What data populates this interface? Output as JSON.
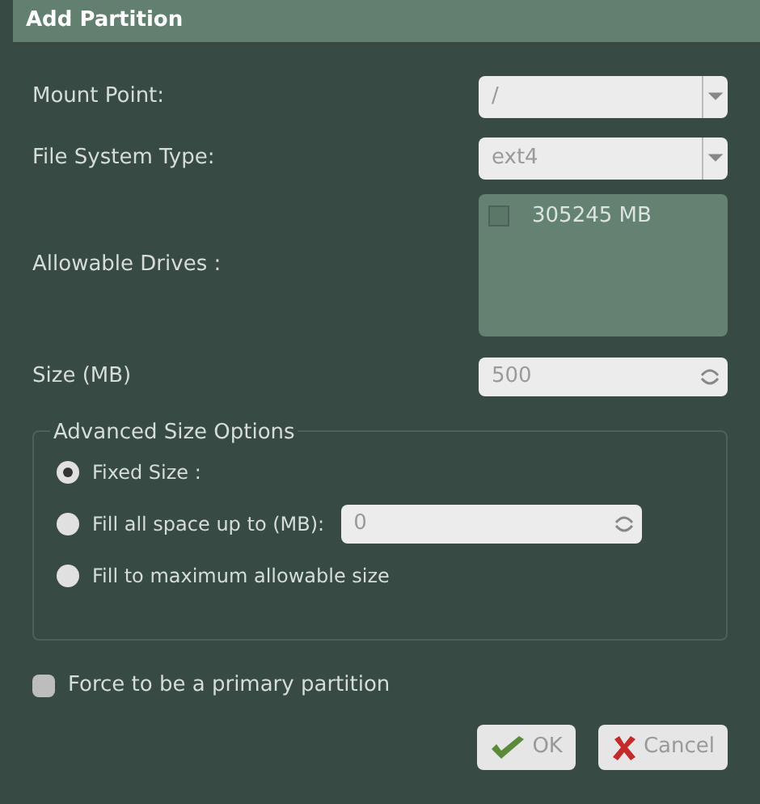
{
  "window": {
    "title": "Add Partition"
  },
  "mount_point": {
    "label": "Mount Point:",
    "value": "/"
  },
  "file_system_type": {
    "label": "File System Type:",
    "value": "ext4"
  },
  "allowable_drives": {
    "label": "Allowable Drives :",
    "items": [
      {
        "label": "305245 MB",
        "checked": false
      }
    ]
  },
  "size": {
    "label": "Size (MB)",
    "value": "500"
  },
  "advanced": {
    "title": "Advanced Size Options",
    "options": [
      {
        "label": "Fixed Size :",
        "selected": true,
        "kind": "plain"
      },
      {
        "label": "Fill all space up to (MB):",
        "selected": false,
        "kind": "spin",
        "value": "0"
      },
      {
        "label": "Fill to maximum allowable size",
        "selected": false,
        "kind": "plain"
      }
    ]
  },
  "primary": {
    "label": "Force to be a primary partition",
    "checked": false
  },
  "buttons": [
    {
      "label": "OK",
      "kind": "ok"
    },
    {
      "label": "Cancel",
      "kind": "cancel"
    }
  ]
}
